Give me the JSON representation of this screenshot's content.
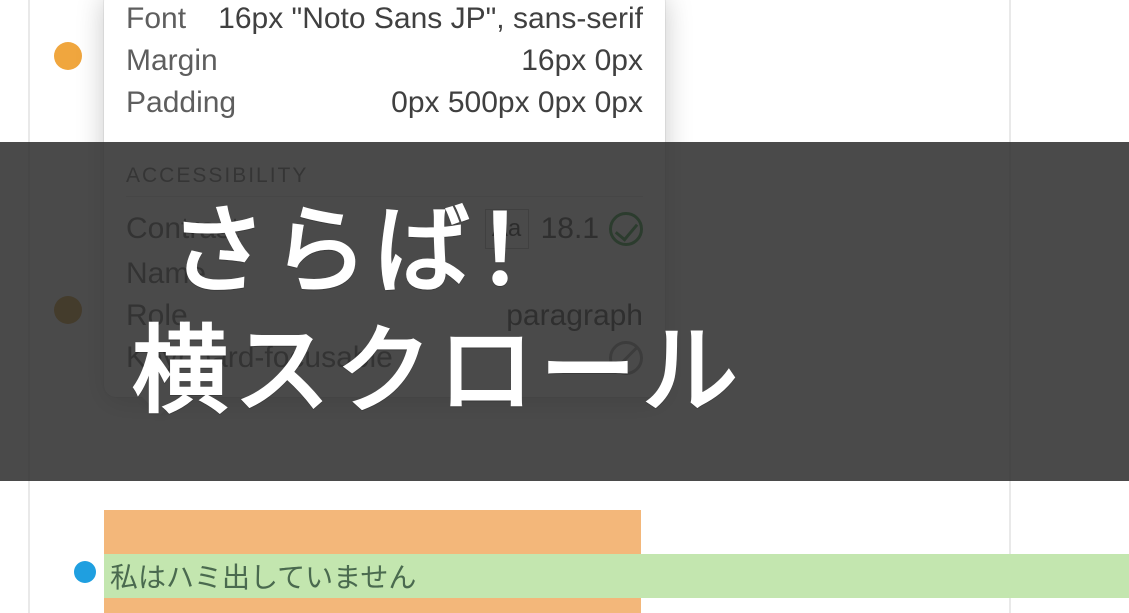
{
  "tooltip": {
    "font_label": "Font",
    "font_value": "16px \"Noto Sans JP\", sans-serif",
    "margin_label": "Margin",
    "margin_value": "16px 0px",
    "padding_label": "Padding",
    "padding_value": "0px 500px 0px 0px",
    "section_title": "ACCESSIBILITY",
    "contrast_label": "Contrast",
    "contrast_swatch": "Aa",
    "contrast_value": "18.1",
    "name_label": "Name",
    "name_value": "",
    "role_label": "Role",
    "role_value": "paragraph",
    "kbd_label": "Keyboard-focusable"
  },
  "page": {
    "green_text": "私はハミ出していません"
  },
  "overlay": {
    "line1": "さらば！",
    "line2": "横スクロール"
  }
}
